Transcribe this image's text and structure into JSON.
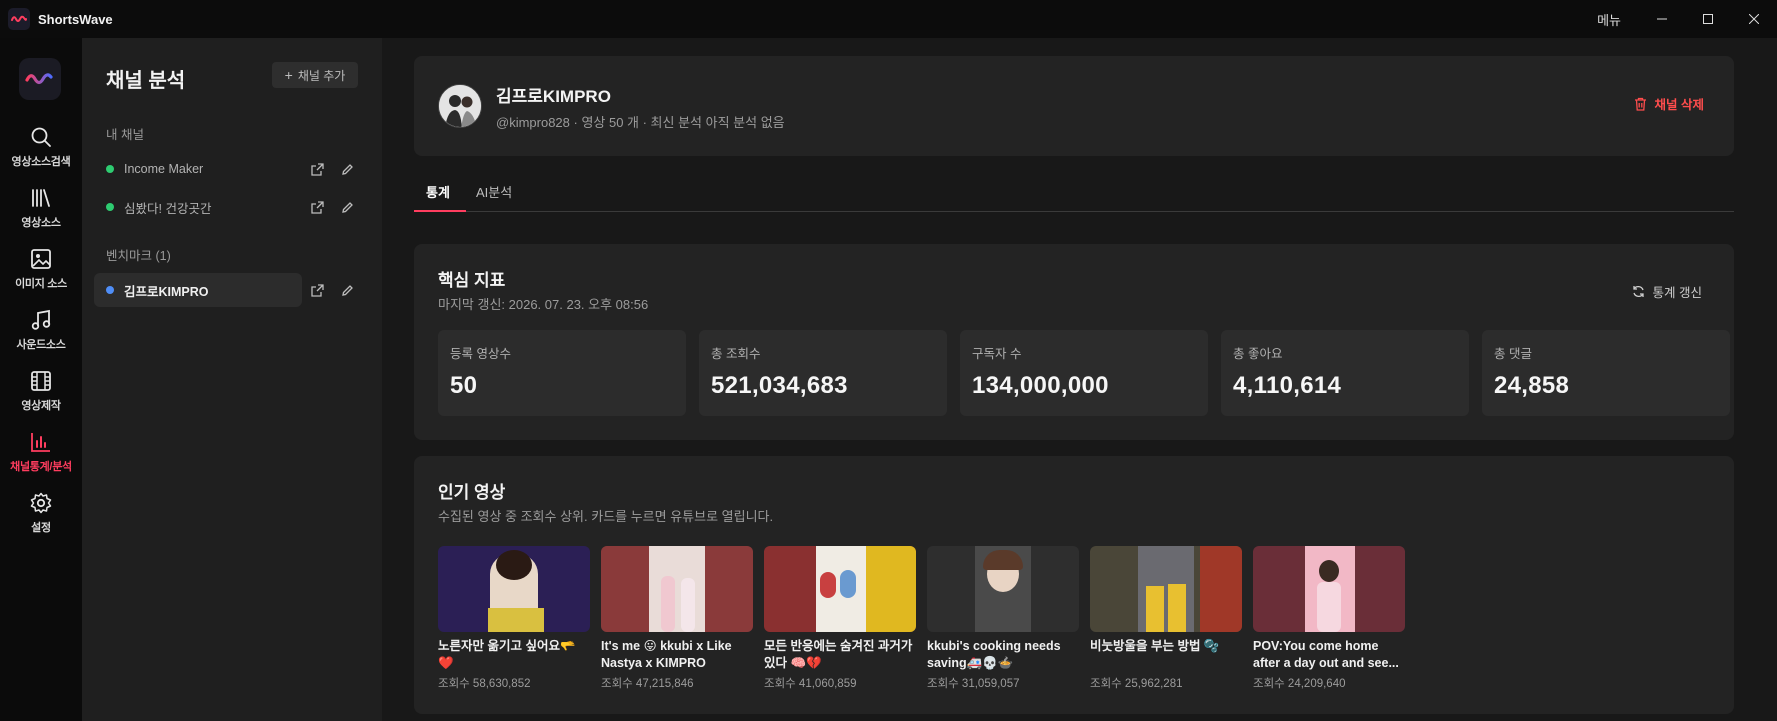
{
  "app": {
    "title": "ShortsWave",
    "menu_label": "메뉴"
  },
  "rail": {
    "items": [
      {
        "label": "영상소스검색",
        "icon": "search-icon"
      },
      {
        "label": "영상소스",
        "icon": "library-icon"
      },
      {
        "label": "이미지 소스",
        "icon": "image-icon"
      },
      {
        "label": "사운드소스",
        "icon": "music-icon"
      },
      {
        "label": "영상제작",
        "icon": "film-icon"
      },
      {
        "label": "채널통계/분석",
        "icon": "bar-chart-icon",
        "active": true
      },
      {
        "label": "설정",
        "icon": "gear-icon"
      }
    ],
    "accent": "#ff3d5f"
  },
  "channels": {
    "title": "채널 분석",
    "add_label": "채널 추가",
    "my_section": "내 채널",
    "my_channels": [
      {
        "name": "Income Maker",
        "dot": "#2ecc71"
      },
      {
        "name": "심봤다! 건강곳간",
        "dot": "#2ecc71"
      }
    ],
    "bench_section": "벤치마크 (1)",
    "bench_channels": [
      {
        "name": "김프로KIMPRO",
        "dot": "#4f8ef7"
      }
    ]
  },
  "profile": {
    "name": "김프로KIMPRO",
    "meta": "@kimpro828 · 영상 50 개 · 최신 분석 아직 분석 없음",
    "delete_label": "채널 삭제"
  },
  "tabs": [
    {
      "label": "통계",
      "active": true
    },
    {
      "label": "AI분석"
    }
  ],
  "kpi": {
    "title": "핵심 지표",
    "updated": "마지막 갱신: 2026. 07. 23. 오후 08:56",
    "refresh_label": "통계 갱신",
    "stats": [
      {
        "label": "등록 영상수",
        "value": "50"
      },
      {
        "label": "총 조회수",
        "value": "521,034,683"
      },
      {
        "label": "구독자 수",
        "value": "134,000,000"
      },
      {
        "label": "총 좋아요",
        "value": "4,110,614"
      },
      {
        "label": "총 댓글",
        "value": "24,858"
      }
    ]
  },
  "popular": {
    "title": "인기 영상",
    "subtitle": "수집된 영상 중 조회수 상위. 카드를 누르면 유튜브로 열립니다.",
    "videos": [
      {
        "title": "노른자만 옮기고 싶어요🫳❤️",
        "views": "조회수 58,630,852",
        "bg": "#3a2a6a"
      },
      {
        "title": "It's me 😛 kkubi x Like Nastya x KIMPRO",
        "views": "조회수 47,215,846",
        "bg": "#caa2a8"
      },
      {
        "title": "모든 반응에는 숨겨진 과거가 있다 🧠💔",
        "views": "조회수 41,060,859",
        "bg": "#b24f4f"
      },
      {
        "title": "kkubi's cooking needs saving🚑💀🍲",
        "views": "조회수 31,059,057",
        "bg": "#3b3b3b"
      },
      {
        "title": "비눗방울을 부는 방법 🫧",
        "views": "조회수 25,962,281",
        "bg": "#5a5240"
      },
      {
        "title": "POV:You come home after a day out and see...",
        "views": "조회수 24,209,640",
        "bg": "#7a3a48"
      }
    ]
  }
}
